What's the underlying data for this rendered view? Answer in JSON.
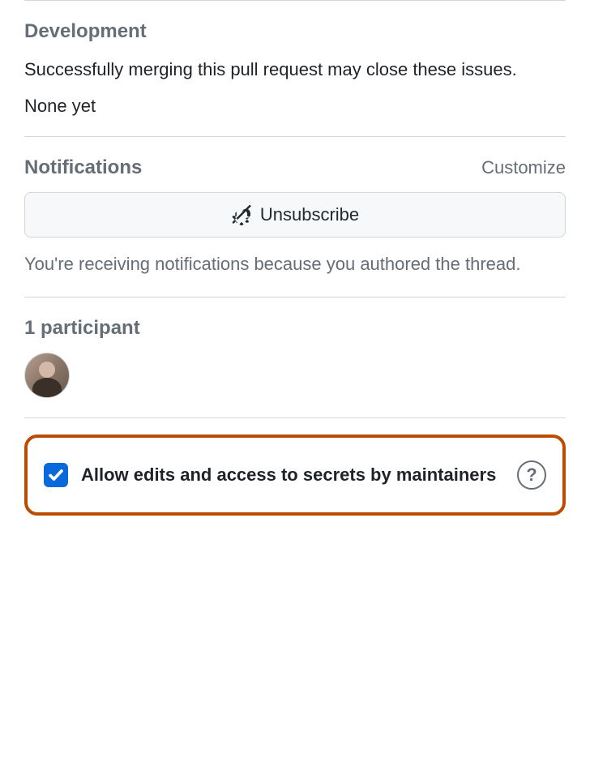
{
  "development": {
    "title": "Development",
    "description": "Successfully merging this pull request may close these issues.",
    "status": "None yet"
  },
  "notifications": {
    "title": "Notifications",
    "customize_label": "Customize",
    "unsubscribe_label": "Unsubscribe",
    "reason": "You're receiving notifications because you authored the thread."
  },
  "participants": {
    "title": "1 participant"
  },
  "allow_edits": {
    "label": "Allow edits and access to secrets by maintainers",
    "checked": true,
    "help_symbol": "?"
  }
}
